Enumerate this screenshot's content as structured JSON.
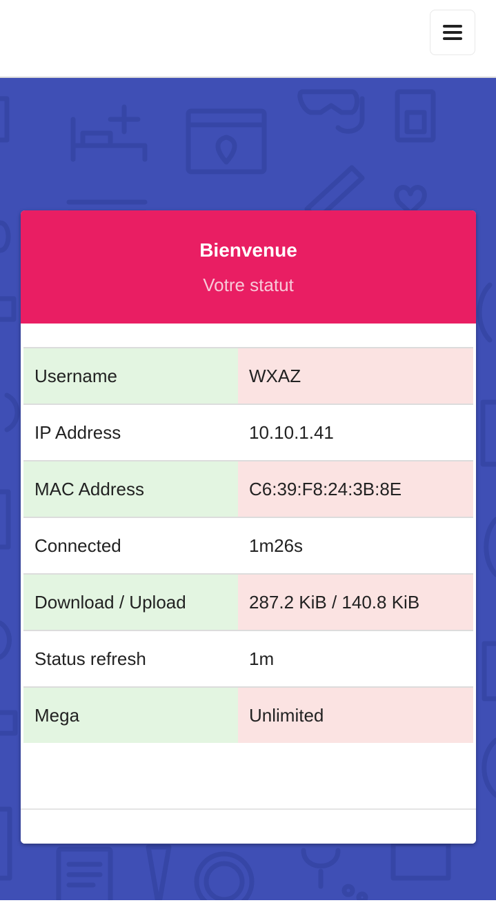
{
  "card": {
    "title": "Bienvenue",
    "subtitle": "Votre statut"
  },
  "status_rows": [
    {
      "label": "Username",
      "value": "WXAZ"
    },
    {
      "label": "IP Address",
      "value": "10.10.1.41"
    },
    {
      "label": "MAC Address",
      "value": "C6:39:F8:24:3B:8E"
    },
    {
      "label": "Connected",
      "value": "1m26s"
    },
    {
      "label": "Download / Upload",
      "value": "287.2 KiB / 140.8 KiB"
    },
    {
      "label": "Status refresh",
      "value": "1m"
    },
    {
      "label": "Mega",
      "value": "Unlimited"
    }
  ],
  "icons": {
    "menu": "hamburger-menu-icon"
  },
  "colors": {
    "header_bg": "#e91e63",
    "hero_bg": "#3f4fb5",
    "label_alt_bg": "#e3f5e1",
    "value_alt_bg": "#fbe3e2"
  }
}
